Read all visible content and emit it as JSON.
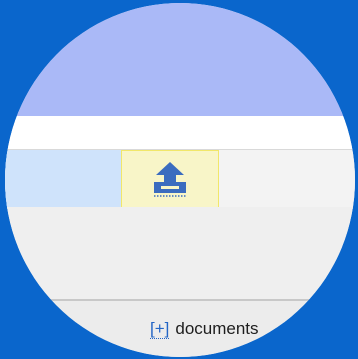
{
  "colors": {
    "background": "#0a66cc",
    "header_band": "#aab9f7",
    "row_selected": "#cfe3fb",
    "upload_highlight": "#f8f5c8",
    "upload_icon": "#3b6cbf"
  },
  "upload": {
    "icon": "upload-icon"
  },
  "footer": {
    "expand_marker": "[+]",
    "link_label": "documents"
  }
}
